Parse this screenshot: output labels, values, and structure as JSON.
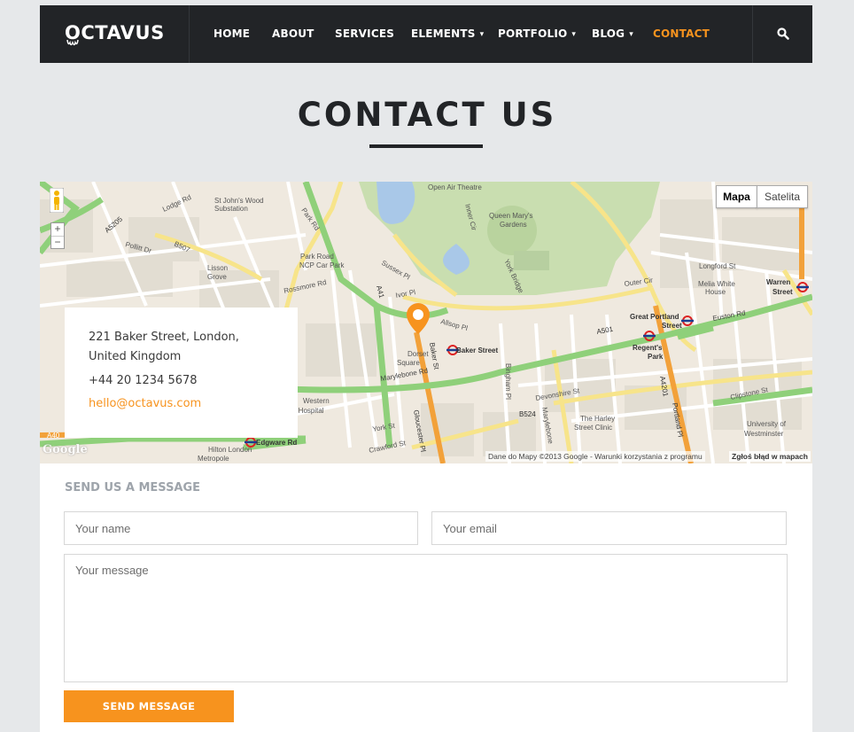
{
  "brand": {
    "name": "OCTAVUS"
  },
  "nav": {
    "items": [
      {
        "label": "HOME"
      },
      {
        "label": "ABOUT"
      },
      {
        "label": "SERVICES"
      },
      {
        "label": "ELEMENTS",
        "caret": "▾"
      },
      {
        "label": "PORTFOLIO",
        "caret": "▾"
      },
      {
        "label": "BLOG",
        "caret": "▾"
      },
      {
        "label": "CONTACT"
      }
    ],
    "active": "CONTACT",
    "search_icon": "search-icon"
  },
  "page": {
    "title": "CONTACT US"
  },
  "map": {
    "type_buttons": {
      "map": "Mapa",
      "satellite": "Satelita"
    },
    "zoom": {
      "in": "+",
      "out": "−"
    },
    "attribution": "Dane do Mapy ©2013 Google - Warunki korzystania z programu",
    "report": "Zgłoś błąd w mapach",
    "logo": "Google",
    "labels": {
      "open_air_theatre": "Open Air Theatre",
      "queen_marys_1": "Queen Mary's",
      "queen_marys_2": "Gardens",
      "baker_street": "Baker Street",
      "great_portland_1": "Great Portland",
      "great_portland_2": "Street",
      "regents_park_1": "Regent's",
      "regents_park_2": "Park",
      "warren_1": "Warren",
      "warren_2": "Street",
      "marylebone_rd": "Marylebone Rd",
      "euston_rd": "Euston Rd",
      "devonshire_st": "Devonshire St",
      "harley_1": "The Harley",
      "harley_2": "Street Clinic",
      "edgware_rd": "Edgware Rd",
      "york_st": "York St",
      "crawford_st": "Crawford St",
      "dorset_1": "Dorset",
      "dorset_2": "Square",
      "lisson_1": "Lisson",
      "lisson_2": "Grove",
      "park_road_1": "Park Road",
      "park_road_2": "NCP Car Park",
      "longford_st": "Longford St",
      "melia_1": "Melia White",
      "melia_2": "House",
      "westminster_1": "University of",
      "westminster_2": "Westminster",
      "outer_cir": "Outer Cir",
      "rossmore_rd": "Rossmore Rd",
      "lodge_rd": "Lodge Rd",
      "pollitt": "Pollitt Dr",
      "a501": "A501",
      "b524": "B524",
      "a40": "A40",
      "st_johns_1": "St John's Wood",
      "st_johns_2": "Substation",
      "bingham_pl": "Bingham Pl",
      "hilton_1": "Hilton London",
      "hilton_2": "Metropole",
      "western_1": "Western",
      "western_2": "e Hospital",
      "a5205": "A5205",
      "park_rd": "Park Rd",
      "a41": "A41",
      "b507": "B507",
      "clipstone": "Clipstone St",
      "york_bridge": "York Bridge",
      "inner_cir": "Inner Cir",
      "sussex_pl": "Sussex Pl",
      "ivor_pl": "Ivor Pl",
      "allsop_pl": "Allsop Pl",
      "baker_st_road": "Baker St",
      "gloucester_pl": "Gloucester Pl",
      "a4201": "A4201",
      "portland_pl": "Portland Pl",
      "marylebone_high": "Marylebone"
    }
  },
  "contact": {
    "address_line1": "221 Baker Street, London,",
    "address_line2": "United Kingdom",
    "phone": "+44 20 1234 5678",
    "email": "hello@octavus.com"
  },
  "form": {
    "heading": "SEND US A MESSAGE",
    "name_placeholder": "Your name",
    "email_placeholder": "Your email",
    "message_placeholder": "Your message",
    "submit_label": "SEND MESSAGE"
  },
  "colors": {
    "accent": "#f7931e",
    "nav_bg": "#222427",
    "page_bg": "#e6e8ea"
  }
}
